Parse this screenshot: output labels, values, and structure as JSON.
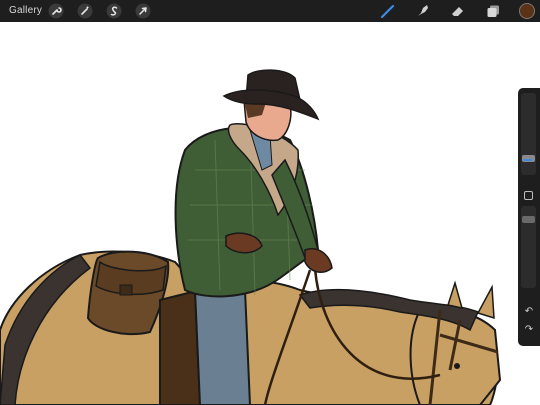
{
  "toolbar": {
    "gallery_label": "Gallery",
    "left_tools": [
      "wrench-icon",
      "magic-wand-icon",
      "selection-s-icon",
      "transform-arrow-icon"
    ],
    "right_tools": [
      "brush-icon",
      "smudge-icon",
      "eraser-icon",
      "layers-icon"
    ],
    "active_tool": "brush-icon",
    "accent_color": "#3b8ae6",
    "current_color": "#5a3215"
  },
  "sidebar": {
    "brush_size_level": 0.25,
    "opacity_level": 0.4,
    "undo_icon": "undo-arrow-icon",
    "redo_icon": "redo-arrow-icon"
  },
  "canvas": {
    "artwork": "cowboy-on-horse-illustration"
  }
}
